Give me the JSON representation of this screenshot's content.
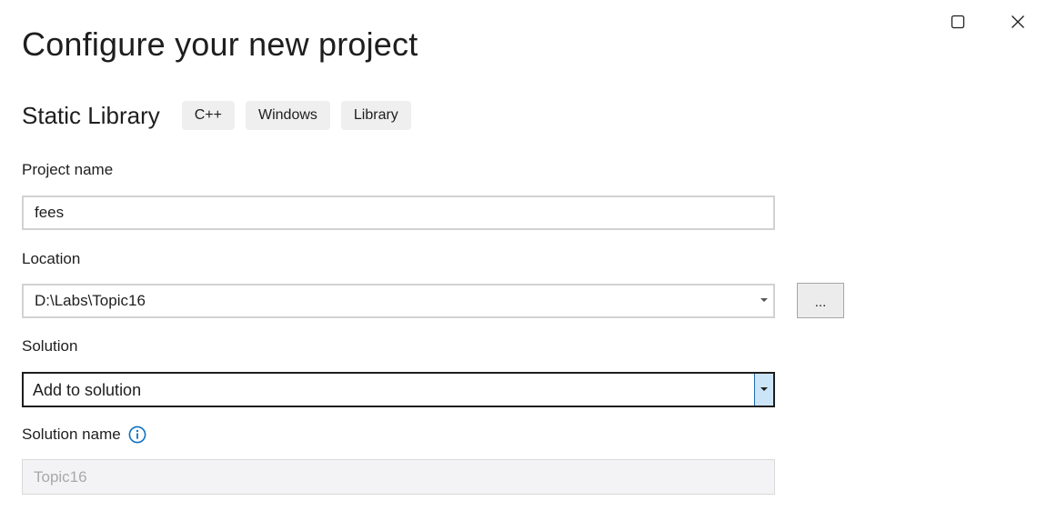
{
  "window": {
    "title": "Configure your new project"
  },
  "template": {
    "name": "Static Library",
    "tags": [
      "C++",
      "Windows",
      "Library"
    ]
  },
  "project_name": {
    "label": "Project name",
    "value": "fees"
  },
  "location": {
    "label": "Location",
    "value": "D:\\Labs\\Topic16",
    "browse_label": "..."
  },
  "solution": {
    "label": "Solution",
    "selected": "Add to solution"
  },
  "solution_name": {
    "label": "Solution name",
    "value": "Topic16",
    "info_icon": "info-icon"
  },
  "colors": {
    "accent": "#0e70c0",
    "dropdown_active": "#cce4f7",
    "tag_bg": "#efefef",
    "disabled_bg": "#f3f3f5"
  }
}
